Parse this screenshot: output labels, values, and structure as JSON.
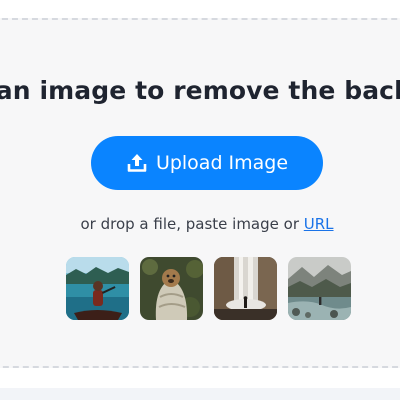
{
  "headline": "Upload an image to remove the background",
  "upload_button": {
    "label": "Upload Image",
    "icon": "upload-icon",
    "color": "#0a84ff"
  },
  "drop_hint": {
    "prefix": "or drop a file, paste image or ",
    "link": "URL"
  },
  "sample_images": [
    {
      "icon": "sample-woman-in-canoe-image"
    },
    {
      "icon": "sample-dog-in-blanket-image"
    },
    {
      "icon": "sample-waterfall-image"
    },
    {
      "icon": "sample-river-valley-image"
    }
  ]
}
